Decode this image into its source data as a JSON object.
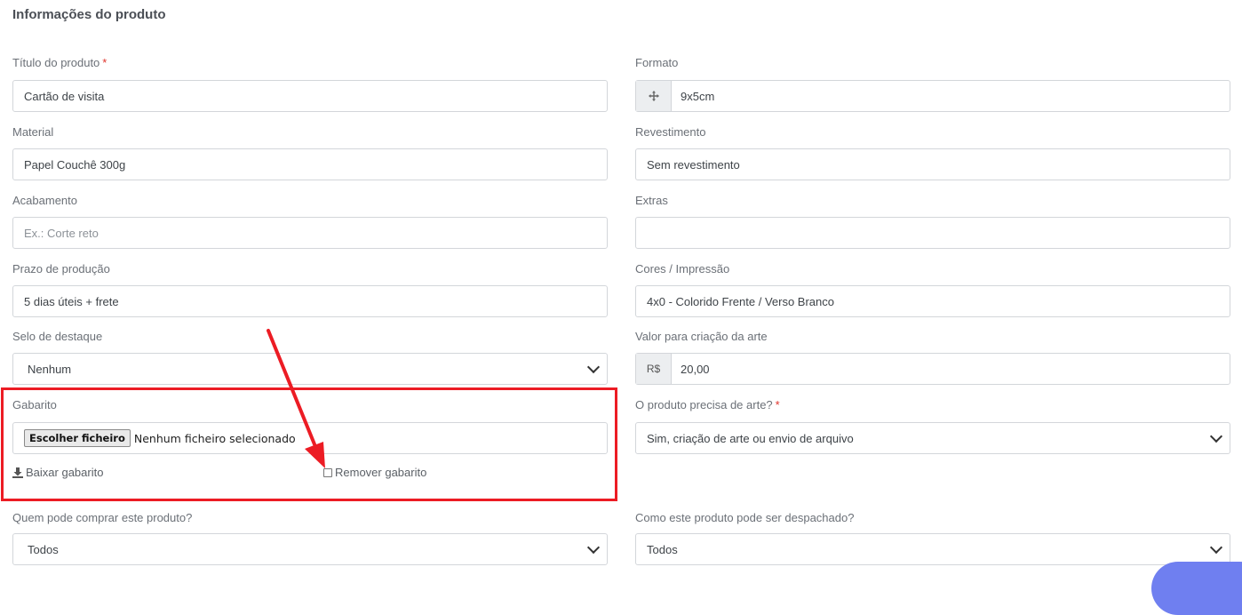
{
  "section_title": "Informações do produto",
  "fields": {
    "titulo": {
      "label": "Título do produto",
      "required_mark": "*",
      "value": "Cartão de visita"
    },
    "formato": {
      "label": "Formato",
      "value": "9x5cm",
      "icon": "move-icon"
    },
    "material": {
      "label": "Material",
      "value": "Papel Couchê 300g"
    },
    "revestimento": {
      "label": "Revestimento",
      "value": "Sem revestimento"
    },
    "acabamento": {
      "label": "Acabamento",
      "value": "",
      "placeholder": "Ex.: Corte reto"
    },
    "extras": {
      "label": "Extras",
      "value": ""
    },
    "prazo": {
      "label": "Prazo de produção",
      "value": "5 dias úteis + frete"
    },
    "cores": {
      "label": "Cores / Impressão",
      "value": "4x0 - Colorido Frente / Verso Branco"
    },
    "selo": {
      "label": "Selo de destaque",
      "value": "Nenhum"
    },
    "valor_arte": {
      "label": "Valor para criação da arte",
      "prefix": "R$",
      "value": "20,00"
    },
    "gabarito": {
      "label": "Gabarito",
      "button": "Escolher ficheiro",
      "status": "Nenhum ficheiro selecionado",
      "download": "Baixar gabarito",
      "remove": "Remover gabarito"
    },
    "precisa_arte": {
      "label": "O produto precisa de arte?",
      "required_mark": "*",
      "value": "Sim, criação de arte ou envio de arquivo"
    },
    "quem_compra": {
      "label": "Quem pode comprar este produto?",
      "value": "Todos"
    },
    "despacho": {
      "label": "Como este produto pode ser despachado?",
      "value": "Todos"
    }
  },
  "annotation": {
    "color": "#ec1c24"
  }
}
